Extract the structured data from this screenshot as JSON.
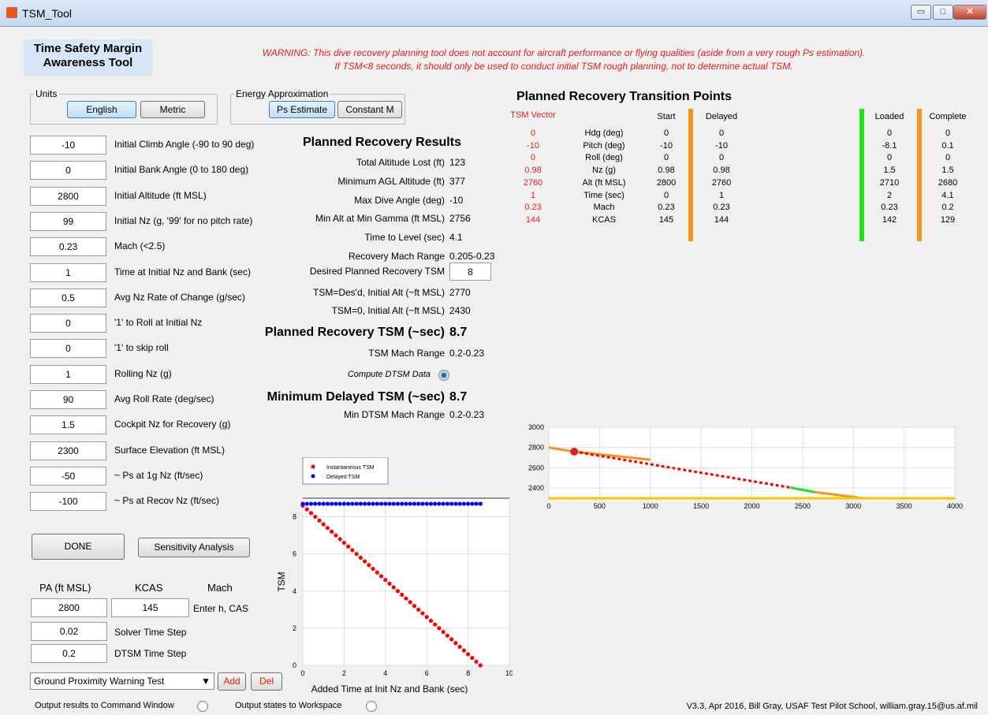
{
  "window": {
    "title": "TSM_Tool",
    "minimize": "▭",
    "maximize": "□",
    "close": "✕"
  },
  "header": {
    "title_line1": "Time Safety Margin",
    "title_line2": "Awareness Tool",
    "warning_line1": "WARNING: This dive recovery planning tool does not account for aircraft performance or flying qualities (aside from a very rough Ps estimation).",
    "warning_line2": "If TSM<8 seconds, it should only be used to conduct initial TSM rough planning, not to determine actual TSM."
  },
  "units": {
    "legend": "Units",
    "english": "English",
    "metric": "Metric"
  },
  "energy": {
    "legend": "Energy Approximation",
    "ps": "Ps Estimate",
    "constm": "Constant M"
  },
  "inputs": [
    {
      "value": "-10",
      "label": "Initial Climb Angle (-90 to 90 deg)"
    },
    {
      "value": "0",
      "label": "Initial Bank Angle (0 to 180 deg)"
    },
    {
      "value": "2800",
      "label": "Initial Altitude (ft MSL)"
    },
    {
      "value": "99",
      "label": "Initial Nz (g, '99' for no pitch rate)"
    },
    {
      "value": "0.23",
      "label": "Mach (<2.5)"
    },
    {
      "value": "1",
      "label": "Time at Initial Nz and Bank (sec)"
    },
    {
      "value": "0.5",
      "label": "Avg Nz Rate of Change (g/sec)"
    },
    {
      "value": "0",
      "label": "'1' to Roll at Initial Nz"
    },
    {
      "value": "0",
      "label": "'1' to skip roll"
    },
    {
      "value": "1",
      "label": "Rolling Nz (g)"
    },
    {
      "value": "90",
      "label": "Avg Roll Rate (deg/sec)"
    },
    {
      "value": "1.5",
      "label": "Cockpit Nz for Recovery (g)"
    },
    {
      "value": "2300",
      "label": "Surface Elevation (ft MSL)"
    },
    {
      "value": "-50",
      "label": "~ Ps at 1g Nz (ft/sec)"
    },
    {
      "value": "-100",
      "label": "~ Ps at Recov Nz (ft/sec)"
    }
  ],
  "buttons": {
    "done": "DONE",
    "sensitivity": "Sensitivity Analysis",
    "add": "Add",
    "del": "Del"
  },
  "atmos": {
    "pa_header": "PA (ft MSL)",
    "kcas_header": "KCAS",
    "mach_header": "Mach",
    "pa": "2800",
    "kcas": "145",
    "enter": "Enter h, CAS",
    "solver_step": "0.02",
    "solver_label": "Solver Time Step",
    "dtsm_step": "0.2",
    "dtsm_label": "DTSM Time Step"
  },
  "scenario": {
    "selected": "Ground Proximity Warning Test"
  },
  "footer": {
    "out_cmd": "Output results to Command Window",
    "out_ws": "Output states to Workspace",
    "credit": "V3.3, Apr 2016, Bill Gray, USAF Test Pilot School, william.gray.15@us.af.mil"
  },
  "results": {
    "title": "Planned Recovery Results",
    "rows": [
      {
        "label": "Total Altitude Lost (ft)",
        "value": "123"
      },
      {
        "label": "Minimum AGL Altitude (ft)",
        "value": "377"
      },
      {
        "label": "Max Dive Angle (deg)",
        "value": "-10"
      },
      {
        "label": "Min Alt at Min Gamma (ft MSL)",
        "value": "2756"
      },
      {
        "label": "Time to Level (sec)",
        "value": "4.1"
      },
      {
        "label": "Recovery Mach Range",
        "value": "0.205-0.23"
      }
    ],
    "desired_label": "Desired Planned Recovery TSM",
    "desired_value": "8",
    "tsm_des_label": "TSM=Des'd, Initial Alt (~ft MSL)",
    "tsm_des_value": "2770",
    "tsm0_label": "TSM=0, Initial Alt (~ft MSL)",
    "tsm0_value": "2430",
    "planned_label": "Planned Recovery TSM (~sec)",
    "planned_value": "8.7",
    "tsm_mach_label": "TSM Mach Range",
    "tsm_mach_value": "0.2-0.23",
    "compute_label": "Compute DTSM Data",
    "min_dtsm_label": "Minimum Delayed TSM (~sec)",
    "min_dtsm_value": "8.7",
    "min_dtsm_mach_label": "Min DTSM Mach Range",
    "min_dtsm_mach_value": "0.2-0.23"
  },
  "transition": {
    "title": "Planned Recovery Transition Points",
    "headers": {
      "vector": "TSM Vector",
      "start": "Start",
      "delayed": "Delayed",
      "loaded": "Loaded",
      "complete": "Complete"
    },
    "rows": [
      {
        "vec": "0",
        "label": "Hdg (deg)",
        "start": "0",
        "delayed": "0",
        "loaded": "0",
        "complete": "0"
      },
      {
        "vec": "-10",
        "label": "Pitch (deg)",
        "start": "-10",
        "delayed": "-10",
        "loaded": "-8.1",
        "complete": "0.1"
      },
      {
        "vec": "0",
        "label": "Roll (deg)",
        "start": "0",
        "delayed": "0",
        "loaded": "0",
        "complete": "0"
      },
      {
        "vec": "0.98",
        "label": "Nz (g)",
        "start": "0.98",
        "delayed": "0.98",
        "loaded": "1.5",
        "complete": "1.5"
      },
      {
        "vec": "2760",
        "label": "Alt (ft MSL)",
        "start": "2800",
        "delayed": "2760",
        "loaded": "2710",
        "complete": "2680"
      },
      {
        "vec": "1",
        "label": "Time (sec)",
        "start": "0",
        "delayed": "1",
        "loaded": "2",
        "complete": "4.1"
      },
      {
        "vec": "0.23",
        "label": "Mach",
        "start": "0.23",
        "delayed": "0.23",
        "loaded": "0.23",
        "complete": "0.2"
      },
      {
        "vec": "144",
        "label": "KCAS",
        "start": "145",
        "delayed": "144",
        "loaded": "142",
        "complete": "129"
      }
    ]
  },
  "chart_data": [
    {
      "type": "scatter",
      "xlabel": "Added Time at Init Nz and Bank (sec)",
      "ylabel": "TSM",
      "xlim": [
        0,
        10
      ],
      "ylim": [
        0,
        9
      ],
      "xticks": [
        0,
        2,
        4,
        6,
        8,
        10
      ],
      "yticks": [
        0,
        2,
        4,
        6,
        8
      ],
      "legend": "top",
      "grid": true,
      "series": [
        {
          "name": "Instantaneous TSM",
          "color": "#ff0000",
          "x_start": 0,
          "x_end": 8.6,
          "x_step": 0.2,
          "y_start": 8.6,
          "y_end": 0
        },
        {
          "name": "Delayed TSM",
          "color": "#0000ff",
          "x_start": 0,
          "x_end": 8.6,
          "x_step": 0.2,
          "y_const": 8.7
        }
      ]
    },
    {
      "type": "line",
      "xlim": [
        0,
        4000
      ],
      "ylim": [
        2300,
        3000
      ],
      "xticks": [
        0,
        500,
        1000,
        1500,
        2000,
        2500,
        3000,
        3500,
        4000
      ],
      "yticks": [
        2400,
        2600,
        2800,
        3000
      ],
      "grid": true,
      "series": [
        {
          "color": "#f7941d",
          "x": [
            0,
            250
          ],
          "y": [
            2800,
            2760
          ]
        },
        {
          "color": "#f7941d",
          "x": [
            250,
            1000
          ],
          "y": [
            2760,
            2680
          ]
        },
        {
          "color": "#ff0000",
          "dashed": true,
          "x": [
            250,
            2380
          ],
          "y": [
            2760,
            2405
          ]
        },
        {
          "color": "#22dd22",
          "x": [
            2380,
            2620
          ],
          "y": [
            2405,
            2360
          ]
        },
        {
          "color": "#f7941d",
          "x": [
            2620,
            3100
          ],
          "y": [
            2360,
            2300
          ]
        },
        {
          "color": "#f7c800",
          "x": [
            0,
            4000
          ],
          "y": [
            2300,
            2300
          ]
        }
      ],
      "marker": {
        "x": 250,
        "y": 2760,
        "color": "#e0201a"
      }
    }
  ]
}
